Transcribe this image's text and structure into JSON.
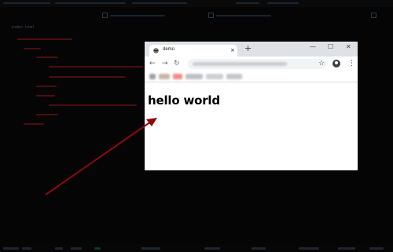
{
  "editor": {
    "file_tab": "index.html"
  },
  "browser": {
    "tab_title": "demo",
    "tab_close": "×",
    "new_tab": "+",
    "window_controls": {
      "minimize": "—",
      "maximize": "☐",
      "close": "✕"
    },
    "nav": {
      "back": "←",
      "forward": "→",
      "reload": "↻"
    },
    "star": "☆",
    "menu": "⋮"
  },
  "page": {
    "heading": "hello world"
  },
  "annotation": {
    "arrow_color": "#8b0a0a"
  }
}
